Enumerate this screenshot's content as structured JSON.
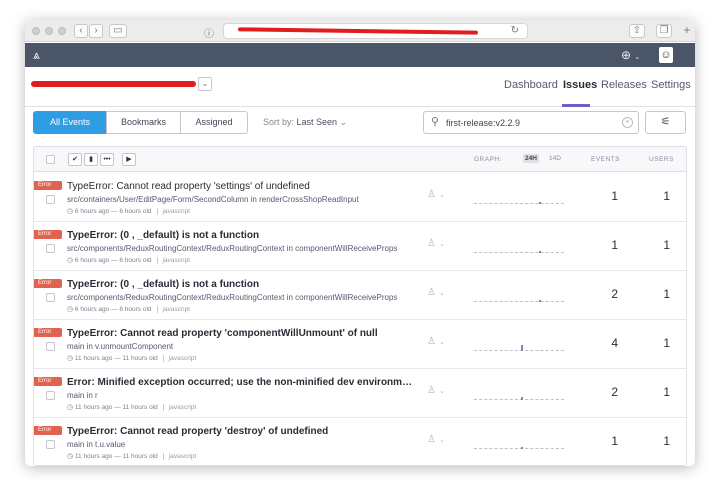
{
  "header": {
    "tabs": [
      {
        "label": "Dashboard",
        "active": false
      },
      {
        "label": "Issues",
        "active": true
      },
      {
        "label": "Releases",
        "active": false
      },
      {
        "label": "Settings",
        "active": false
      }
    ]
  },
  "filters": {
    "segments": [
      "All Events",
      "Bookmarks",
      "Assigned"
    ],
    "sort_label": "Sort by:",
    "sort_value": "Last Seen",
    "search_value": "first-release:v2.2.9"
  },
  "list_header": {
    "graph_label": "GRAPH:",
    "period_24h": "24H",
    "period_14d": "14D",
    "events_label": "EVENTS",
    "users_label": "USERS"
  },
  "issues": [
    {
      "level": "Error",
      "title": "TypeError: Cannot read property 'settings' of undefined",
      "culprit": "src/containers/User/EditPage/Form/SecondColumn in renderCrossShopReadInput",
      "time": "6 hours ago — 6 hours old",
      "platform": "javascript",
      "events": "1",
      "users": "1",
      "bold": false,
      "tick_pos": 0.72,
      "tick_h": 2
    },
    {
      "level": "Error",
      "title": "TypeError: (0 , _default) is not a function",
      "culprit": "src/components/ReduxRoutingContext/ReduxRoutingContext in componentWillReceiveProps",
      "time": "6 hours ago — 6 hours old",
      "platform": "javascript",
      "events": "1",
      "users": "1",
      "bold": true,
      "tick_pos": 0.72,
      "tick_h": 2
    },
    {
      "level": "Error",
      "title": "TypeError: (0 , _default) is not a function",
      "culprit": "src/components/ReduxRoutingContext/ReduxRoutingContext in componentWillReceiveProps",
      "time": "6 hours ago — 6 hours old",
      "platform": "javascript",
      "events": "2",
      "users": "1",
      "bold": true,
      "tick_pos": 0.72,
      "tick_h": 2
    },
    {
      "level": "Error",
      "title": "TypeError: Cannot read property 'componentWillUnmount' of null",
      "culprit": "main in v.unmountComponent",
      "time": "11 hours ago — 11 hours old",
      "platform": "javascript",
      "events": "4",
      "users": "1",
      "bold": true,
      "tick_pos": 0.52,
      "tick_h": 6
    },
    {
      "level": "Error",
      "title": "Error: Minified exception occurred; use the non-minified dev environment for the full error message",
      "culprit": "main in r",
      "time": "11 hours ago — 11 hours old",
      "platform": "javascript",
      "events": "2",
      "users": "1",
      "bold": true,
      "tick_pos": 0.52,
      "tick_h": 3
    },
    {
      "level": "Error",
      "title": "TypeError: Cannot read property 'destroy' of undefined",
      "culprit": "main in t.u.value",
      "time": "11 hours ago — 11 hours old",
      "platform": "javascript",
      "events": "1",
      "users": "1",
      "bold": true,
      "tick_pos": 0.52,
      "tick_h": 2
    }
  ],
  "colors": {
    "accent": "#2f9de4",
    "header_bg": "#4a5568",
    "error": "#e0624f"
  }
}
